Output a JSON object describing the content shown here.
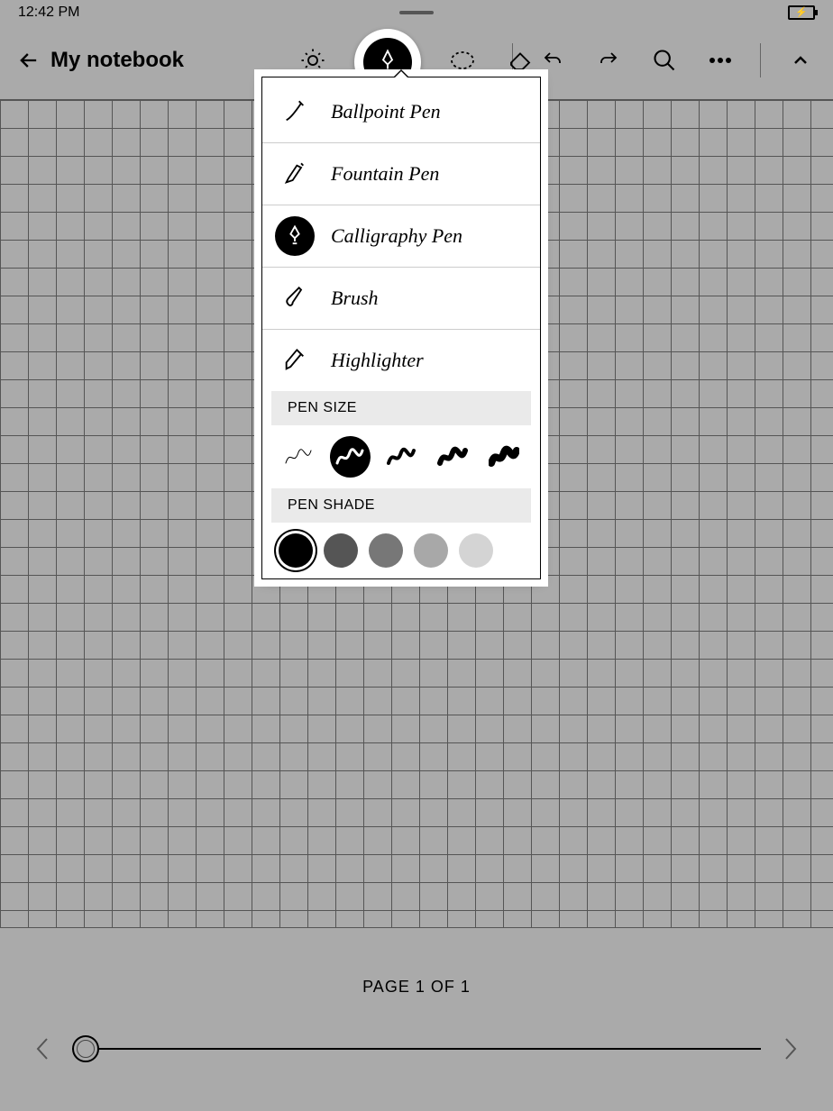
{
  "status": {
    "time": "12:42 PM"
  },
  "header": {
    "title": "My notebook"
  },
  "footer": {
    "page_label": "PAGE 1 OF 1"
  },
  "popover": {
    "pens": [
      {
        "id": "ballpoint",
        "label": "Ballpoint Pen",
        "selected": false
      },
      {
        "id": "fountain",
        "label": "Fountain Pen",
        "selected": false
      },
      {
        "id": "calligraphy",
        "label": "Calligraphy Pen",
        "selected": true
      },
      {
        "id": "brush",
        "label": "Brush",
        "selected": false
      },
      {
        "id": "highlighter",
        "label": "Highlighter",
        "selected": false
      }
    ],
    "section_size": "PEN SIZE",
    "section_shade": "PEN SHADE",
    "sizes": [
      {
        "id": "xs",
        "weight": 1,
        "selected": false
      },
      {
        "id": "s",
        "weight": 3,
        "selected": true
      },
      {
        "id": "m",
        "weight": 4,
        "selected": false
      },
      {
        "id": "l",
        "weight": 6,
        "selected": false
      },
      {
        "id": "xl",
        "weight": 8,
        "selected": false
      }
    ],
    "shades": [
      {
        "id": "black",
        "color": "#000000",
        "selected": true
      },
      {
        "id": "dark",
        "color": "#555555",
        "selected": false
      },
      {
        "id": "mid",
        "color": "#777777",
        "selected": false
      },
      {
        "id": "light",
        "color": "#a8a8a8",
        "selected": false
      },
      {
        "id": "pale",
        "color": "#d4d4d4",
        "selected": false
      }
    ]
  }
}
